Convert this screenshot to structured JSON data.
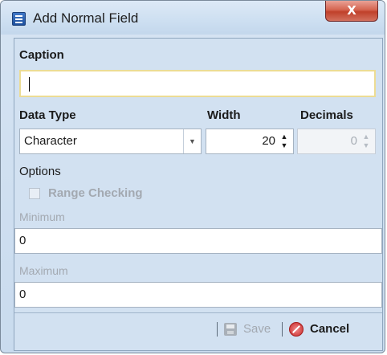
{
  "window": {
    "title": "Add Normal Field",
    "close_symbol": "X"
  },
  "caption": {
    "label": "Caption",
    "value": ""
  },
  "data_type": {
    "label": "Data Type",
    "selected": "Character"
  },
  "width": {
    "label": "Width",
    "value": "20"
  },
  "decimals": {
    "label": "Decimals",
    "value": "0"
  },
  "options": {
    "label": "Options",
    "range_checking_label": "Range Checking",
    "range_checking_checked": false
  },
  "minimum": {
    "label": "Minimum",
    "value": "0"
  },
  "maximum": {
    "label": "Maximum",
    "value": "0"
  },
  "footer": {
    "save_label": "Save",
    "cancel_label": "Cancel"
  },
  "icons": {
    "app": "app-icon",
    "close": "close-icon",
    "dropdown": "chevron-down-icon",
    "spinner": "spinner-icon",
    "save": "save-icon",
    "cancel": "cancel-icon"
  },
  "colors": {
    "accent_caption_border": "#ecdc94",
    "dialog_background": "#d2e1f1",
    "close_button": "#c0412a",
    "cancel_icon": "#c82828"
  }
}
